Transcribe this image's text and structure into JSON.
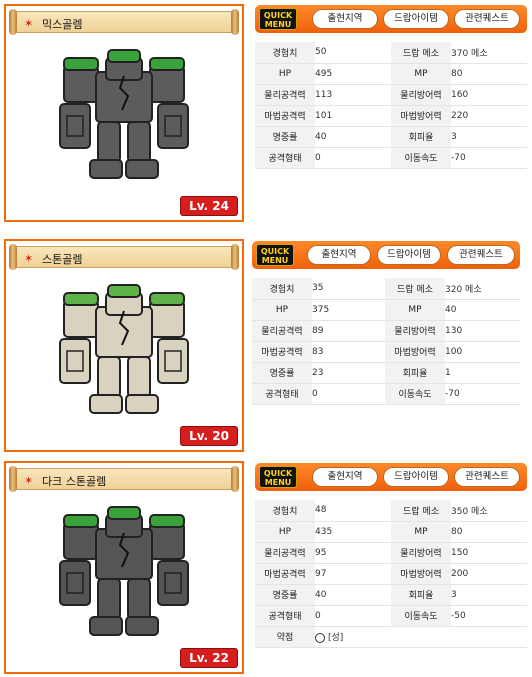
{
  "labels": {
    "exp": "경험치",
    "drop_meso": "드랍 메소",
    "hp": "HP",
    "mp": "MP",
    "phys_atk": "물리공격력",
    "phys_def": "물리방어력",
    "mag_atk": "마법공격력",
    "mag_def": "마법방어력",
    "accuracy": "명중률",
    "evasion": "회피율",
    "attack_type": "공격형태",
    "move_speed": "이동속도",
    "weakness": "약점"
  },
  "quick_menu": {
    "label_line1": "QUICK",
    "label_line2": "MENU",
    "btn_location": "출현지역",
    "btn_drop": "드랍아이템",
    "btn_quest": "관련퀘스트"
  },
  "monsters": [
    {
      "name": "믹스골렘",
      "level": "Lv. 24",
      "exp": "50",
      "meso": "370 메소",
      "hp": "495",
      "mp": "80",
      "phys_atk": "113",
      "phys_def": "160",
      "mag_atk": "101",
      "mag_def": "220",
      "accuracy": "40",
      "evasion": "3",
      "attack_type": "0",
      "move_speed": "-70",
      "colors": {
        "body": "#5c5c5c",
        "moss": "#3aa23a"
      }
    },
    {
      "name": "스톤골렘",
      "level": "Lv. 20",
      "exp": "35",
      "meso": "320 메소",
      "hp": "375",
      "mp": "40",
      "phys_atk": "89",
      "phys_def": "130",
      "mag_atk": "83",
      "mag_def": "100",
      "accuracy": "23",
      "evasion": "1",
      "attack_type": "0",
      "move_speed": "-70",
      "colors": {
        "body": "#d8d2bf",
        "moss": "#5fb247"
      }
    },
    {
      "name": "다크 스톤골렘",
      "level": "Lv. 22",
      "exp": "48",
      "meso": "350 메소",
      "hp": "435",
      "mp": "80",
      "phys_atk": "95",
      "phys_def": "150",
      "mag_atk": "97",
      "mag_def": "200",
      "accuracy": "40",
      "evasion": "3",
      "attack_type": "0",
      "move_speed": "-50",
      "weakness_value": "[성]",
      "colors": {
        "body": "#555555",
        "moss": "#3aa23a"
      }
    }
  ]
}
